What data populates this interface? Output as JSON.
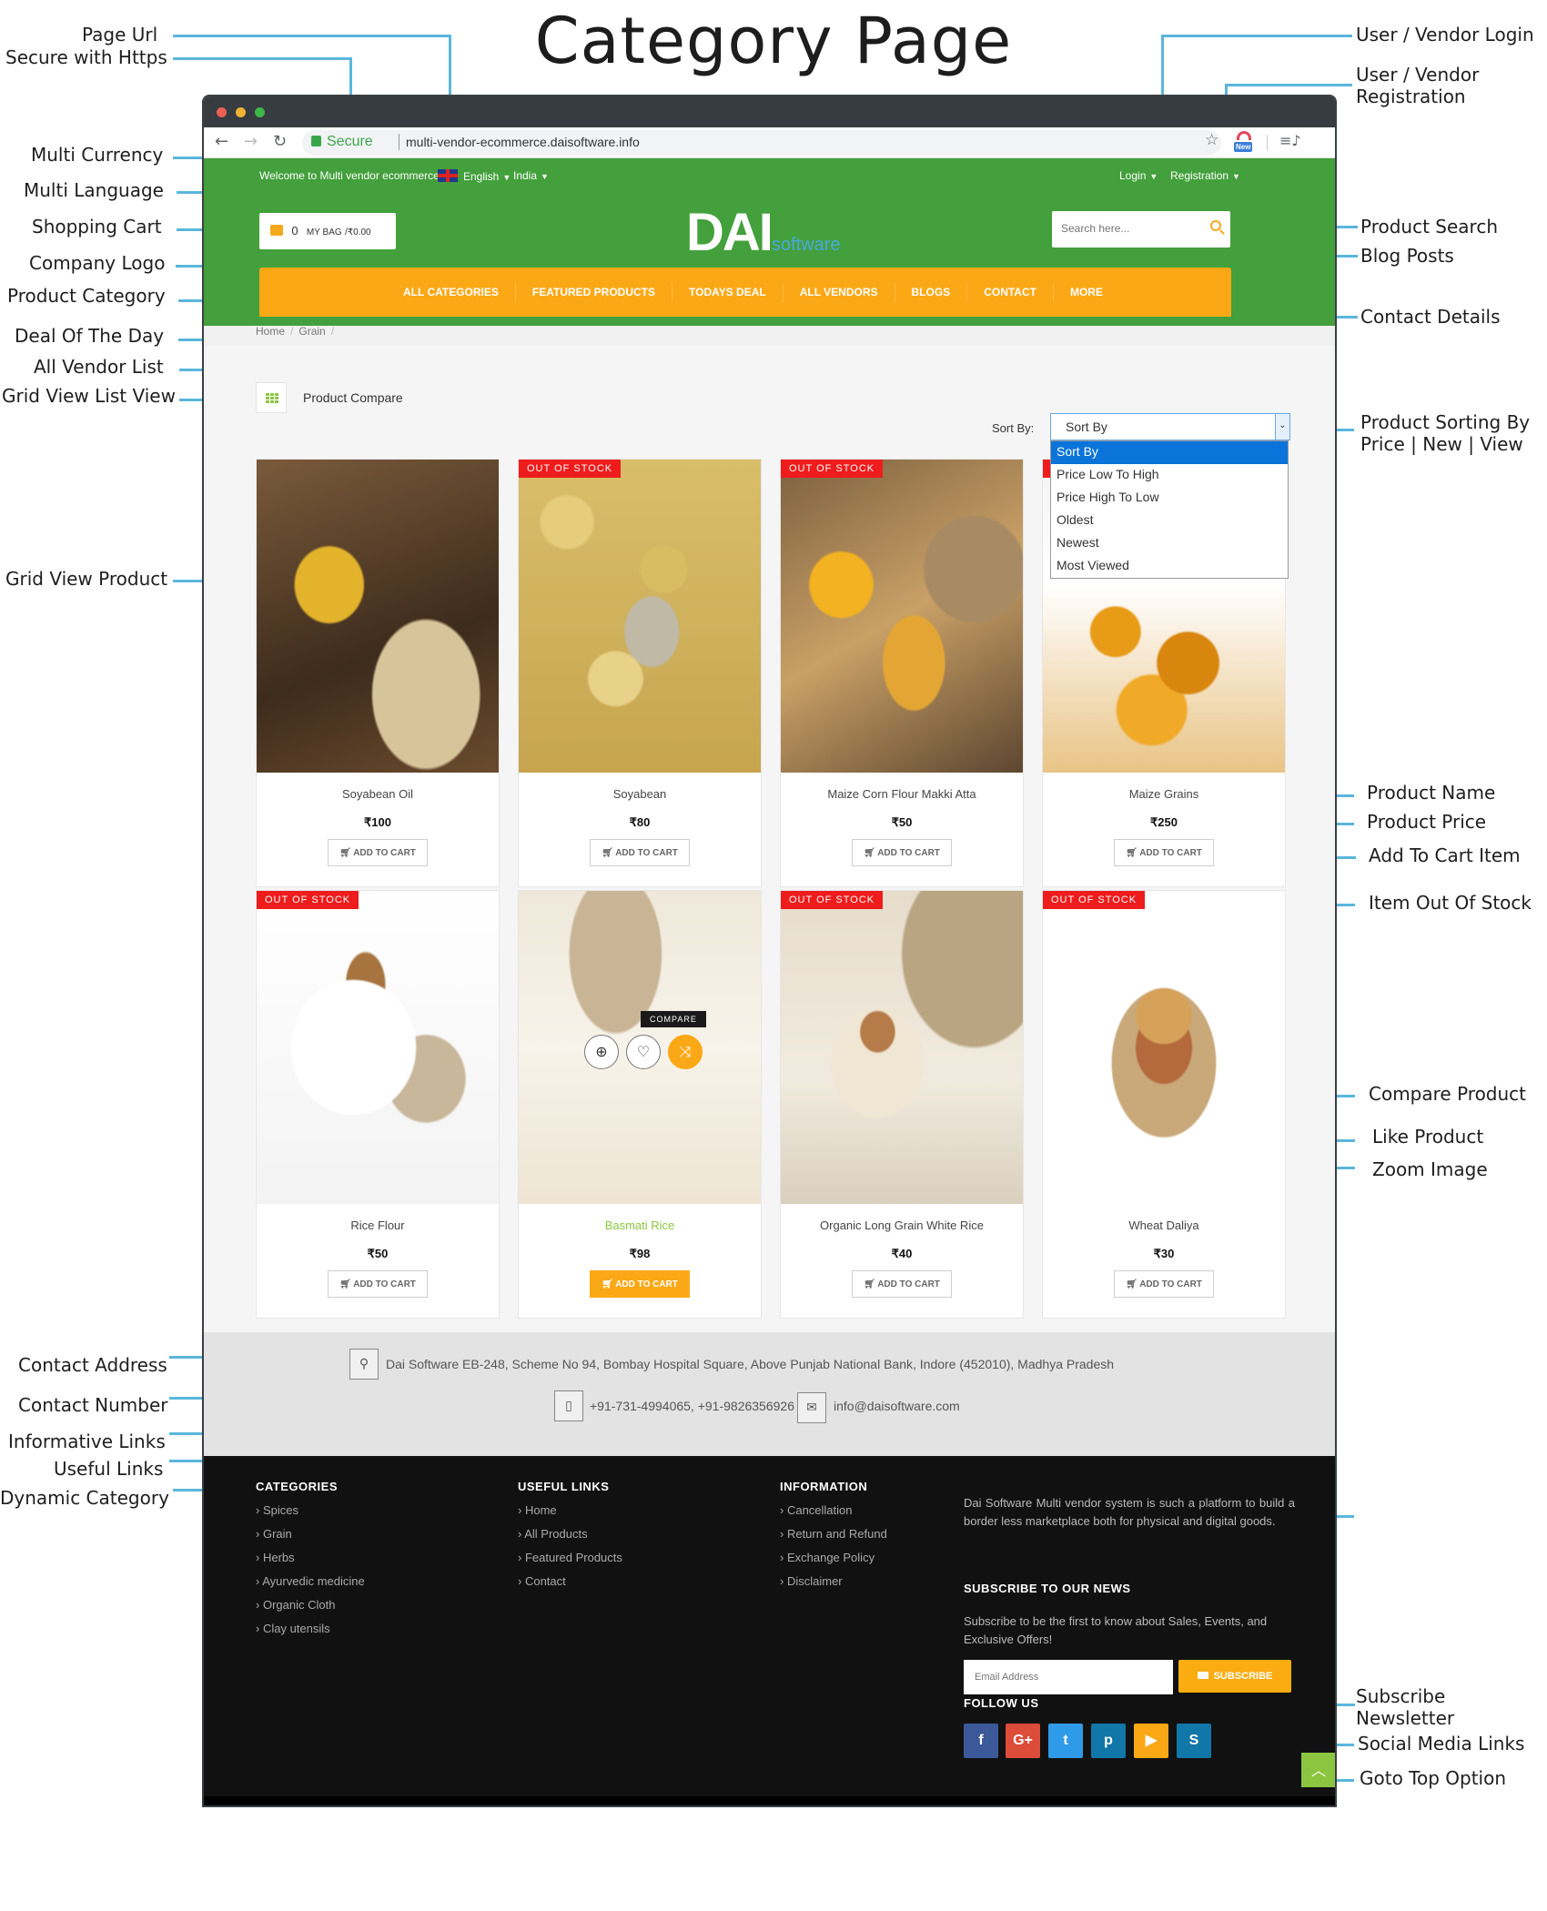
{
  "title": "Category Page",
  "annotations": {
    "left": [
      "Page Url",
      "Secure with Https",
      "Multi Currency",
      "Multi Language",
      "Shopping Cart",
      "Company Logo",
      "Product Category",
      "Deal Of The Day",
      "All Vendor List",
      "Grid View List View",
      "Grid View Product",
      "Contact Address",
      "Contact Number",
      "Informative Links",
      "Useful Links",
      "Dynamic Category"
    ],
    "right": [
      "User / Vendor Login",
      "User / Vendor Registration",
      "Product Search",
      "Blog Posts",
      "Contact Details",
      "Product Sorting By Price | New | View",
      "Product Name",
      "Product Price",
      "Add To Cart Item",
      "Item Out Of Stock",
      "Compare Product",
      "Like Product",
      "Zoom Image",
      "Subscribe Newsletter",
      "Social Media Links",
      "Goto Top Option"
    ]
  },
  "browser": {
    "secure_label": "Secure",
    "url": "multi-vendor-ecommerce.daisoftware.info",
    "extension_badge": "New"
  },
  "header": {
    "welcome": "Welcome to Multi vendor ecommerce!",
    "language": "English",
    "currency": "India",
    "login": "Login",
    "registration": "Registration",
    "cart": {
      "count": "0",
      "label": "MY BAG",
      "total": "/₹0.00"
    },
    "logo": {
      "main": "DAI",
      "sub": "software"
    },
    "search_placeholder": "Search here..."
  },
  "menu": [
    "ALL CATEGORIES",
    "FEATURED PRODUCTS",
    "TODAYS DEAL",
    "ALL VENDORS",
    "BLOGS",
    "CONTACT",
    "MORE"
  ],
  "breadcrumb": [
    "Home",
    "Grain"
  ],
  "toolbar": {
    "compare_label": "Product Compare",
    "sort_label": "Sort By:",
    "sort_selected": "Sort By",
    "sort_options": [
      "Sort By",
      "Price Low To High",
      "Price High To Low",
      "Oldest",
      "Newest",
      "Most Viewed"
    ]
  },
  "products": [
    {
      "name": "Soyabean Oil",
      "price": "₹100",
      "out_of_stock": false,
      "cart": "ADD TO CART"
    },
    {
      "name": "Soyabean",
      "price": "₹80",
      "out_of_stock": true,
      "cart": "ADD TO CART"
    },
    {
      "name": "Maize Corn Flour Makki Atta",
      "price": "₹50",
      "out_of_stock": true,
      "cart": "ADD TO CART"
    },
    {
      "name": "Maize Grains",
      "price": "₹250",
      "out_of_stock": true,
      "cart": "ADD TO CART"
    },
    {
      "name": "Rice Flour",
      "price": "₹50",
      "out_of_stock": true,
      "cart": "ADD TO CART"
    },
    {
      "name": "Basmati Rice",
      "price": "₹98",
      "out_of_stock": false,
      "cart": "ADD TO CART",
      "hovered": true
    },
    {
      "name": "Organic Long Grain White Rice",
      "price": "₹40",
      "out_of_stock": true,
      "cart": "ADD TO CART"
    },
    {
      "name": "Wheat Daliya",
      "price": "₹30",
      "out_of_stock": true,
      "cart": "ADD TO CART"
    }
  ],
  "badge_label": "OUT OF STOCK",
  "compare_tooltip": "COMPARE",
  "contact": {
    "address": "Dai Software EB-248, Scheme No 94, Bombay Hospital Square, Above Punjab National Bank, Indore (452010), Madhya Pradesh",
    "phone": "+91-731-4994065, +91-9826356926",
    "email": "info@daisoftware.com"
  },
  "footer": {
    "categories_title": "CATEGORIES",
    "categories": [
      "Spices",
      "Grain",
      "Herbs",
      "Ayurvedic medicine",
      "Organic Cloth",
      "Clay utensils"
    ],
    "useful_title": "USEFUL LINKS",
    "useful": [
      "Home",
      "All Products",
      "Featured Products",
      "Contact"
    ],
    "info_title": "INFORMATION",
    "info": [
      "Cancellation",
      "Return and Refund",
      "Exchange Policy",
      "Disclaimer"
    ],
    "punchline": "Dai Software Multi vendor system is such a platform to build a border less marketplace both for physical and digital goods.",
    "subscribe_title": "SUBSCRIBE TO OUR NEWS",
    "subscribe_text": "Subscribe to be the first to know about Sales, Events, and Exclusive Offers!",
    "email_placeholder": "Email Address",
    "subscribe_button": "SUBSCRIBE",
    "follow_title": "FOLLOW US",
    "social": [
      {
        "icon": "facebook-icon",
        "glyph": "f",
        "color": "#3b5998"
      },
      {
        "icon": "google-plus-icon",
        "glyph": "G+",
        "color": "#dd4b39"
      },
      {
        "icon": "twitter-icon",
        "glyph": "t",
        "color": "#2f9be8"
      },
      {
        "icon": "pinterest-icon",
        "glyph": "p",
        "color": "#1176a8"
      },
      {
        "icon": "youtube-icon",
        "glyph": "▶",
        "color": "#fba817"
      },
      {
        "icon": "skype-icon",
        "glyph": "S",
        "color": "#1176a8"
      }
    ]
  },
  "colors": {
    "green": "#43a03c",
    "orange": "#fba817",
    "red_badge": "#ee1c1c",
    "callout": "#5ab6dc",
    "footer": "#111111"
  }
}
